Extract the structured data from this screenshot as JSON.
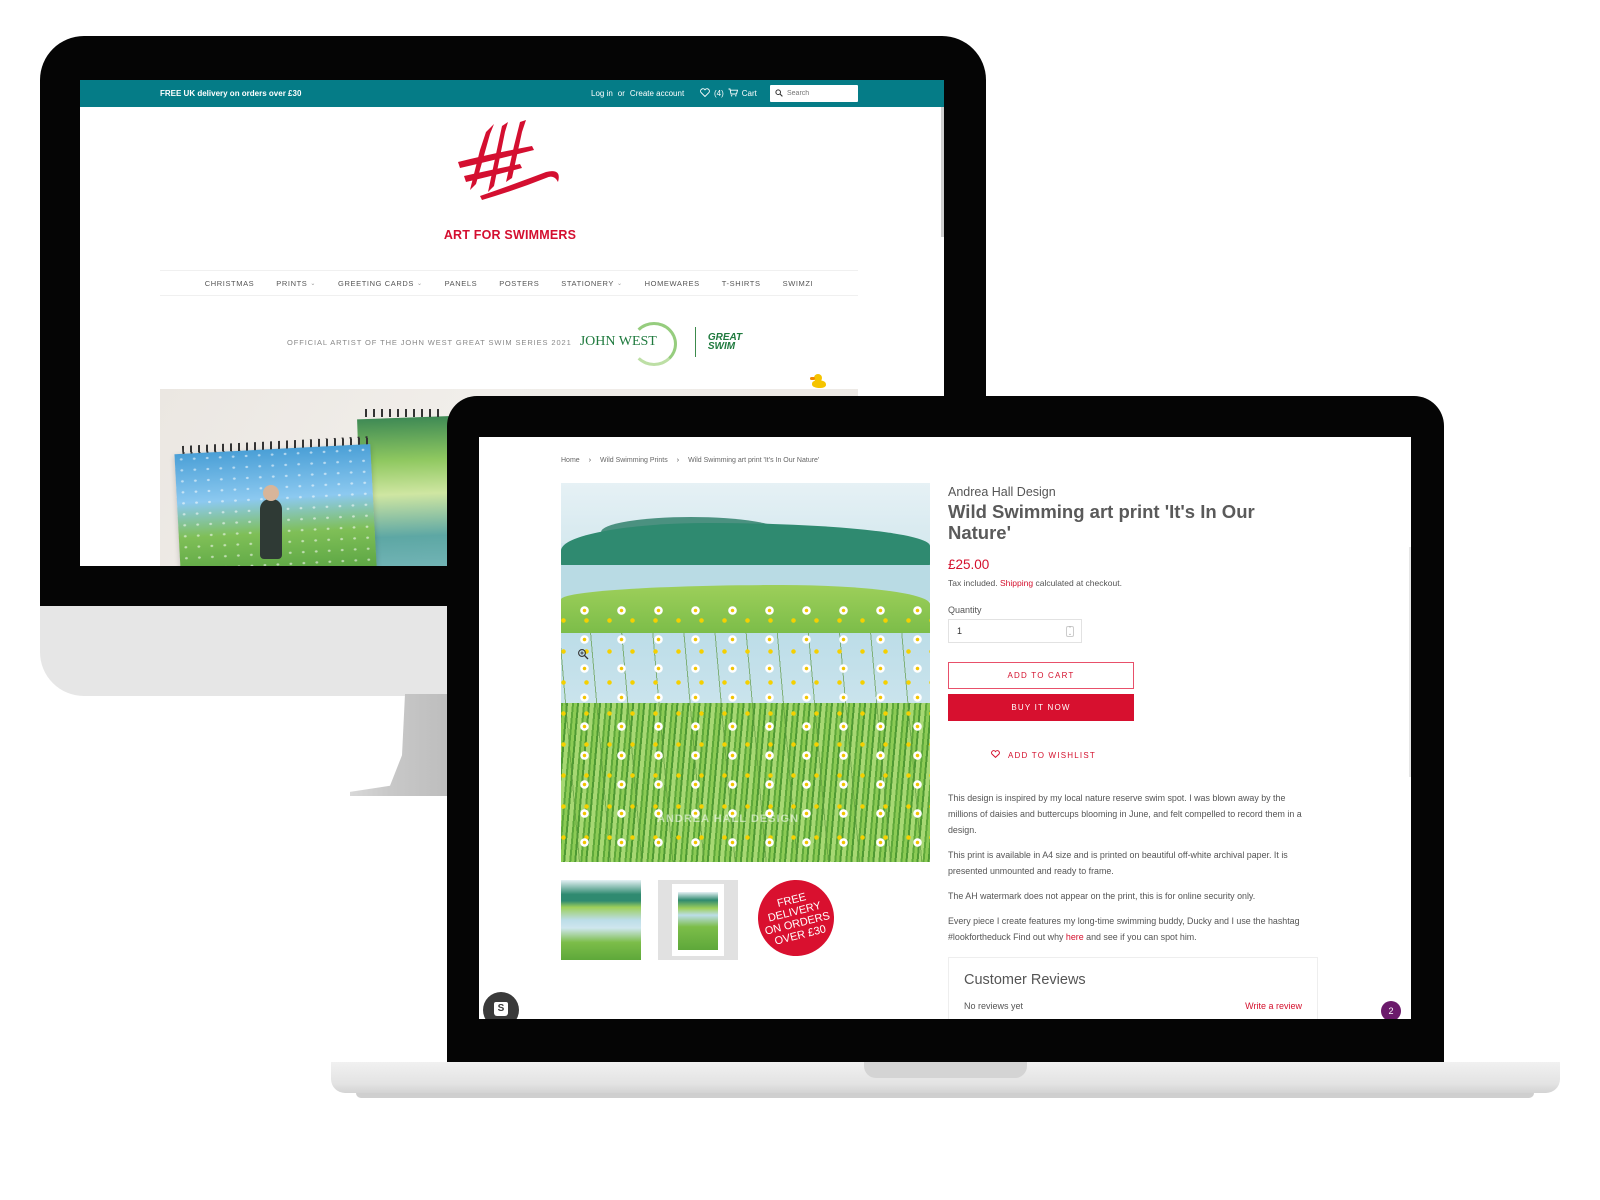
{
  "desktop": {
    "topbar": {
      "promo": "FREE UK delivery on orders over £30",
      "login_label": "Log in",
      "or_label": "or",
      "create_account_label": "Create account",
      "wishlist_count": "(4)",
      "cart_label": "Cart",
      "search_placeholder": "Search",
      "color": "#057c87"
    },
    "brand": {
      "logo_icon": "ah-brush-logo",
      "name": "ART FOR SWIMMERS",
      "color": "#d40f30"
    },
    "nav": [
      {
        "label": "CHRISTMAS",
        "dropdown": false
      },
      {
        "label": "PRINTS",
        "dropdown": true
      },
      {
        "label": "GREETING CARDS",
        "dropdown": true
      },
      {
        "label": "PANELS",
        "dropdown": false
      },
      {
        "label": "POSTERS",
        "dropdown": false
      },
      {
        "label": "STATIONERY",
        "dropdown": true
      },
      {
        "label": "HOMEWARES",
        "dropdown": false
      },
      {
        "label": "T-SHIRTS",
        "dropdown": false
      },
      {
        "label": "SWIMZI",
        "dropdown": false
      }
    ],
    "partner": {
      "text": "OFFICIAL ARTIST OF THE JOHN WEST GREAT SWIM SERIES 2021",
      "logo1": "JOHN WEST",
      "logo2_line1": "GREAT",
      "logo2_line2": "SWIM"
    }
  },
  "laptop": {
    "breadcrumb": [
      "Home",
      "Wild Swimming Prints",
      "Wild Swimming art print 'It's In Our Nature'"
    ],
    "breadcrumb_sep": "›",
    "product": {
      "vendor": "Andrea Hall Design",
      "title": "Wild Swimming art print 'It's In Our Nature'",
      "price": "£25.00",
      "tax_prefix": "Tax included.",
      "shipping_link": "Shipping",
      "tax_suffix": "calculated at checkout.",
      "quantity_label": "Quantity",
      "quantity_value": "1",
      "add_to_cart": "ADD TO CART",
      "buy_now": "BUY IT NOW",
      "wishlist": "ADD TO WISHLIST",
      "watermark": "ANDREA HALL DESIGN",
      "free_delivery_badge": "FREE\nDELIVERY\nON ORDERS\nOVER £30",
      "accent_color": "#d7102f"
    },
    "description": [
      "This design is inspired by my local nature reserve swim spot. I was blown away by the millions of daisies and buttercups blooming in June, and felt compelled to record them in a design.",
      "This print is available in A4 size and is printed on beautiful off-white archival paper. It is presented unmounted and ready to frame.",
      "The AH watermark does not appear on the print, this is for online security only."
    ],
    "description_last": {
      "before": "Every piece I create features my long-time swimming buddy, Ducky and I use the hashtag #lookfortheduck Find out why ",
      "link": "here",
      "after": " and see if you can spot him."
    },
    "reviews": {
      "title": "Customer Reviews",
      "empty": "No reviews yet",
      "write": "Write a review"
    },
    "chat_badge_count": "2",
    "shopify_badge": "S"
  }
}
